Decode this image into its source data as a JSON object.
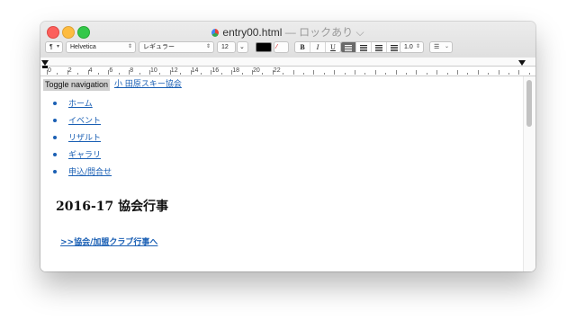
{
  "window": {
    "filename": "entry00.html",
    "separator": " — ",
    "locked_label": "ロックあり",
    "locked_chevron": "⌵"
  },
  "toolbar": {
    "paragraph_style": "¶",
    "font_family": "Helvetica",
    "font_style": "レギュラー",
    "font_size": "12",
    "bold": "B",
    "italic": "I",
    "underline": "U",
    "line_spacing": "1.0"
  },
  "ruler": {
    "labels": [
      "0",
      "2",
      "4",
      "6",
      "8",
      "10",
      "12",
      "14",
      "16",
      "18",
      "20",
      "22"
    ]
  },
  "document": {
    "toggle_navigation": "Toggle navigation",
    "brand": "小 田原スキー協会",
    "nav_items": [
      "ホーム",
      "イベント",
      "リザルト",
      "ギャラリ",
      "申込/問合せ"
    ],
    "heading": "2016-17 協会行事",
    "sublink": ">>協会/加盟クラブ行事へ"
  },
  "colors": {
    "link": "#1a5fb4",
    "close": "#fc605c",
    "minimize": "#fdbc40",
    "maximize": "#34c84a"
  }
}
